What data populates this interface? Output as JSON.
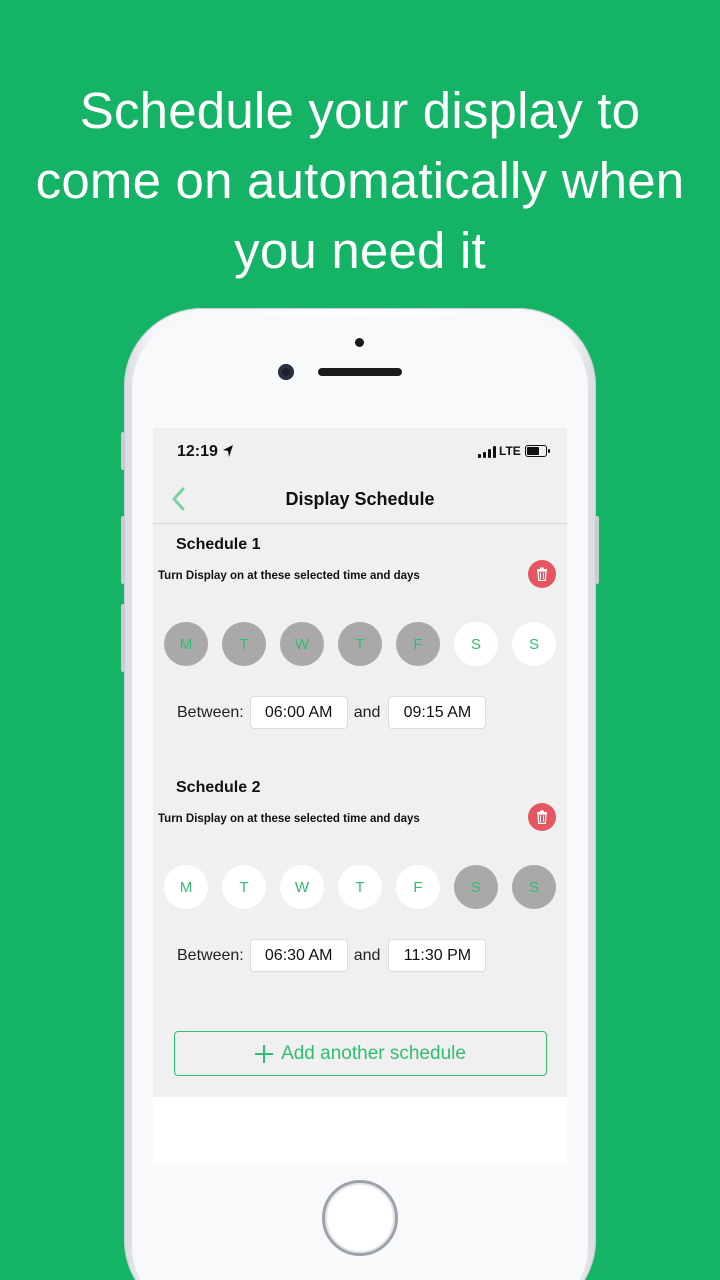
{
  "headline": {
    "line1": "Schedule your display to",
    "line2": "come on automatically when",
    "line3": "you need it"
  },
  "colors": {
    "background": "#15b365",
    "accent": "#2fbf71",
    "delete": "#e65562",
    "day_selected": "#a9a9a9"
  },
  "status_bar": {
    "time": "12:19",
    "network": "LTE",
    "location_icon": "location-arrow-icon",
    "signal_icon": "signal-bars-icon",
    "battery_icon": "battery-icon"
  },
  "nav": {
    "back_icon": "chevron-left-icon",
    "title": "Display Schedule"
  },
  "schedules": [
    {
      "title": "Schedule 1",
      "subtitle": "Turn Display on at these selected time and days",
      "delete_icon": "trash-icon",
      "days": [
        {
          "label": "M",
          "selected": true
        },
        {
          "label": "T",
          "selected": true
        },
        {
          "label": "W",
          "selected": true
        },
        {
          "label": "T",
          "selected": true
        },
        {
          "label": "F",
          "selected": true
        },
        {
          "label": "S",
          "selected": false
        },
        {
          "label": "S",
          "selected": false
        }
      ],
      "between_label": "Between:",
      "start_time": "06:00 AM",
      "and_label": "and",
      "end_time": "09:15 AM"
    },
    {
      "title": "Schedule 2",
      "subtitle": "Turn Display on at these selected time and days",
      "delete_icon": "trash-icon",
      "days": [
        {
          "label": "M",
          "selected": false
        },
        {
          "label": "T",
          "selected": false
        },
        {
          "label": "W",
          "selected": false
        },
        {
          "label": "T",
          "selected": false
        },
        {
          "label": "F",
          "selected": false
        },
        {
          "label": "S",
          "selected": true
        },
        {
          "label": "S",
          "selected": true
        }
      ],
      "between_label": "Between:",
      "start_time": "06:30 AM",
      "and_label": "and",
      "end_time": "11:30 PM"
    }
  ],
  "add_button": {
    "icon": "plus-icon",
    "label": "Add another schedule"
  }
}
